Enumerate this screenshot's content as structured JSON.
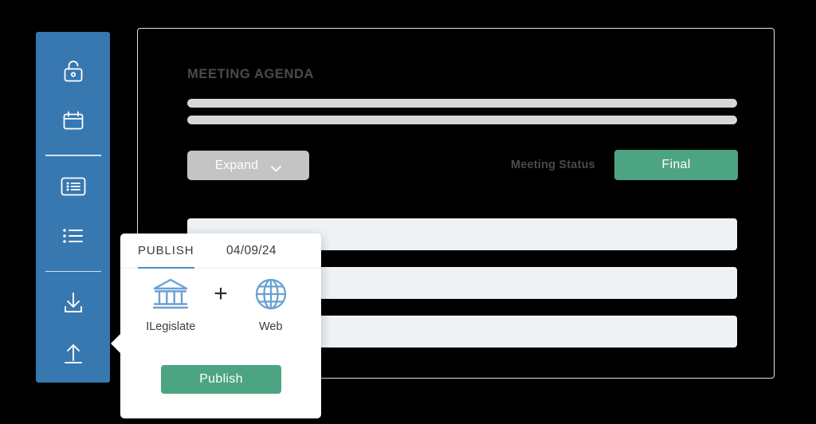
{
  "colors": {
    "sidebar_blue": "#3778b0",
    "accent_green": "#4da482",
    "tab_underline_blue": "#4a8fd0",
    "expand_gray": "#c4c4c4",
    "row_placeholder": "#eef2f5",
    "skeleton_gray": "#d7d7d7",
    "icon_blue": "#6aa0d2"
  },
  "sidebar": {
    "items": [
      {
        "name": "unlock-icon",
        "label": "Unlock"
      },
      {
        "name": "calendar-icon",
        "label": "Calendar"
      },
      {
        "name": "list-box-icon",
        "label": "Agenda List"
      },
      {
        "name": "bullet-list-icon",
        "label": "Items List"
      },
      {
        "name": "download-icon",
        "label": "Download"
      },
      {
        "name": "upload-icon",
        "label": "Publish"
      }
    ]
  },
  "main": {
    "title": "MEETING AGENDA",
    "expand_label": "Expand",
    "meeting_status_label": "Meeting Status",
    "meeting_status_value": "Final",
    "rows": [
      "",
      "",
      ""
    ]
  },
  "popup": {
    "tab_label": "PUBLISH",
    "date": "04/09/24",
    "targets": [
      {
        "icon": "bank-icon",
        "label": "ILegislate"
      },
      {
        "icon": "globe-icon",
        "label": "Web"
      }
    ],
    "plus": "+",
    "publish_label": "Publish"
  }
}
